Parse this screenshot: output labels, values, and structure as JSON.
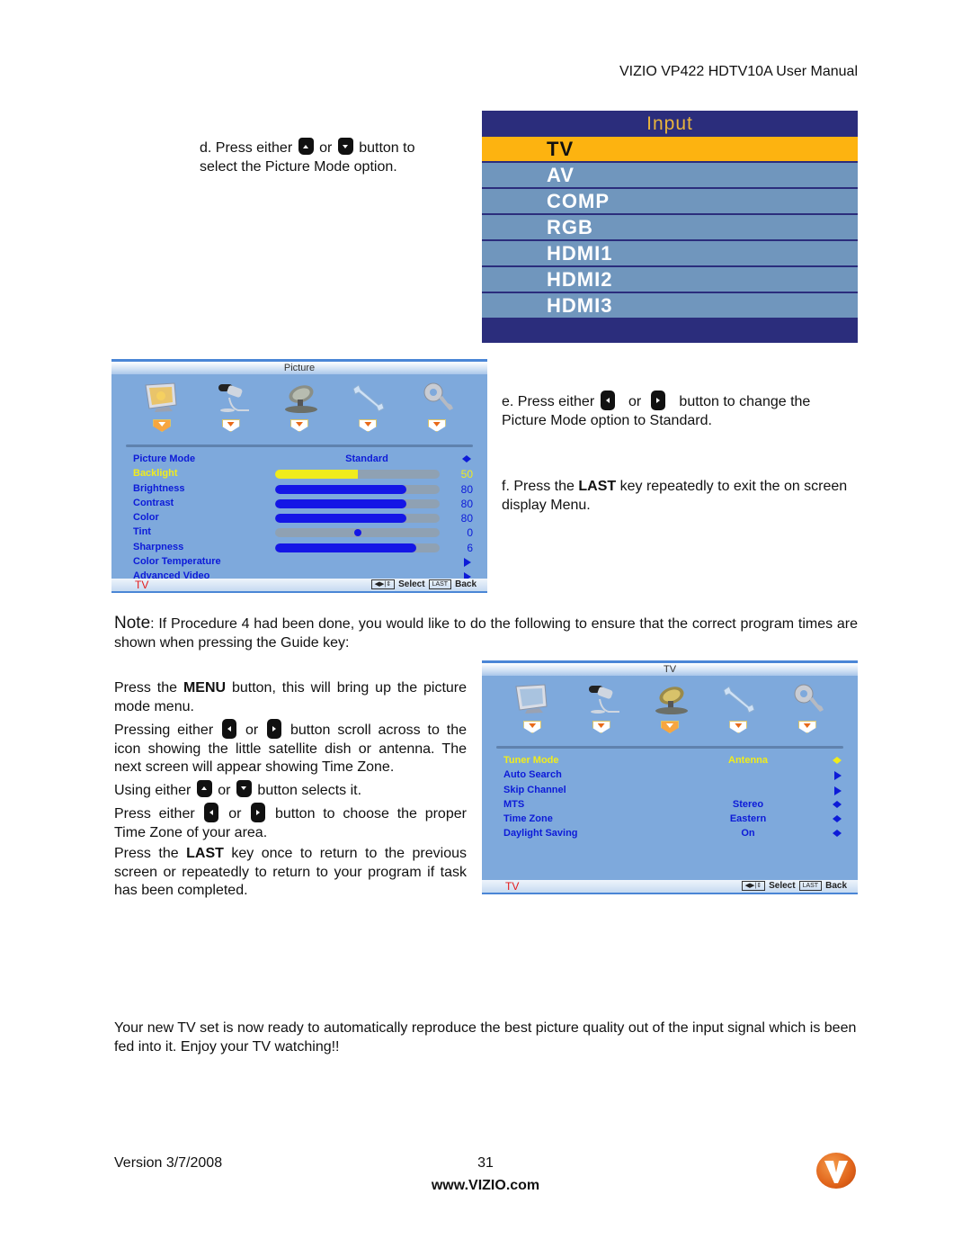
{
  "header": {
    "title": "VIZIO VP422 HDTV10A User Manual"
  },
  "step_d": {
    "prefix": "d. Press either",
    "or": "or",
    "suffix": "button to",
    "line2": "select the Picture Mode option.",
    "keys": [
      "up-key-icon",
      "down-key-icon"
    ]
  },
  "input_menu": {
    "title": "Input",
    "items": [
      {
        "label": "TV",
        "selected": true
      },
      {
        "label": "AV"
      },
      {
        "label": "COMP"
      },
      {
        "label": "RGB"
      },
      {
        "label": "HDMI1"
      },
      {
        "label": "HDMI2"
      },
      {
        "label": "HDMI3"
      }
    ]
  },
  "picture_osd": {
    "title": "Picture",
    "tabs": [
      "picture-icon",
      "audio-icon",
      "tv-tuner-icon",
      "setup-icon",
      "parental-icon"
    ],
    "active_tab": 0,
    "rows": [
      {
        "label": "Picture Mode",
        "value": "Standard",
        "control": "lr-arrows"
      },
      {
        "label": "Backlight",
        "level": 50,
        "highlighted": true,
        "control": "bar"
      },
      {
        "label": "Brightness",
        "level": 80,
        "control": "bar"
      },
      {
        "label": "Contrast",
        "level": 80,
        "control": "bar"
      },
      {
        "label": "Color",
        "level": 80,
        "control": "bar"
      },
      {
        "label": "Tint",
        "level": 0,
        "control": "center-slider",
        "range": [
          -50,
          50
        ]
      },
      {
        "label": "Sharpness",
        "level": 6,
        "control": "bar",
        "max": 7
      },
      {
        "label": "Color Temperature",
        "control": "submenu"
      },
      {
        "label": "Advanced Video",
        "control": "submenu"
      }
    ],
    "footer": {
      "source": "TV",
      "select_label": "Select",
      "back_key": "LAST",
      "back_label": "Back"
    }
  },
  "step_e": {
    "prefix": "e. Press either",
    "or": "or",
    "suffix": "button to change the",
    "line2": "Picture Mode option to Standard."
  },
  "step_f": {
    "prefix": "f. Press the",
    "bold": "LAST",
    "suffix": "key repeatedly to exit the on screen display Menu."
  },
  "note": {
    "label": "Note",
    "text": ": If Procedure 4 had been done, you would like to do the following to ensure that the correct program times are shown when pressing the Guide key:"
  },
  "instructions": {
    "p1": {
      "prefix": "Press the",
      "bold": "MENU",
      "suffix": "button, this will bring up the picture mode menu."
    },
    "p2": {
      "prefix": "Pressing either",
      "or": "or",
      "suffix": "button scroll across to the icon showing the little satellite dish or antenna. The next screen will appear showing Time Zone."
    },
    "p3": {
      "prefix": "Using either",
      "or": "or",
      "suffix": "button selects it."
    },
    "p4": {
      "prefix": "Press either",
      "or": "or",
      "suffix": "button to choose the proper Time Zone of your area."
    },
    "p5": {
      "prefix": "Press the",
      "bold": "LAST",
      "suffix": "key once to return to the previous screen or repeatedly to return to your program if task has been completed."
    }
  },
  "tv_osd": {
    "title": "TV",
    "active_tab": 2,
    "rows": [
      {
        "label": "Tuner Mode",
        "value": "Antenna",
        "highlighted": true,
        "control": "lr-arrows"
      },
      {
        "label": "Auto Search",
        "control": "submenu"
      },
      {
        "label": "Skip Channel",
        "control": "submenu"
      },
      {
        "label": "MTS",
        "value": "Stereo",
        "control": "lr-arrows"
      },
      {
        "label": "Time Zone",
        "value": "Eastern",
        "control": "lr-arrows"
      },
      {
        "label": "Daylight Saving",
        "value": "On",
        "control": "lr-arrows"
      }
    ],
    "footer": {
      "source": "TV",
      "select_label": "Select",
      "back_key": "LAST",
      "back_label": "Back"
    }
  },
  "closing": "Your new TV set is now ready to automatically reproduce the best picture quality out of the input signal which is been fed into it. Enjoy your TV watching!!",
  "footer": {
    "version": "Version 3/7/2008",
    "page": "31",
    "url": "www.VIZIO.com",
    "logo": "vizio-logo-icon"
  },
  "colors": {
    "osd_bg": "#7ea9dc",
    "osd_text": "#0d1bd8",
    "highlight": "#f0ec1c",
    "input_bg": "#2b2d7c",
    "input_selected": "#fdb310",
    "input_item": "#7096bd",
    "source_red": "#e41a1a"
  }
}
